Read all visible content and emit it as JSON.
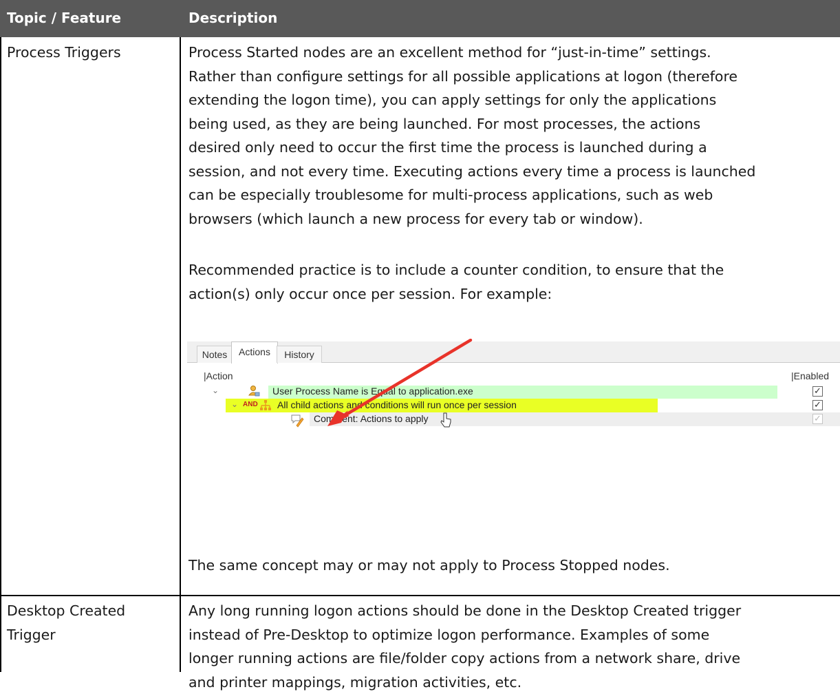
{
  "table": {
    "headers": [
      "Topic / Feature",
      "Description"
    ],
    "rows": [
      {
        "topic": "Process Triggers",
        "para1_lines": [
          "Process Started nodes are an excellent method for “just-in-time” settings.",
          "Rather than configure settings for all possible applications at logon (therefore",
          "extending the logon time), you can apply settings for only the applications",
          "being used, as they are being launched. For most processes, the actions",
          "desired only need to occur the first time the process is launched during a",
          "session, and not every time. Executing actions every time a process is launched",
          "can be especially troublesome for multi-process applications, such as web",
          "browsers (which launch a new process for every tab or window)."
        ],
        "para2_lines": [
          "Recommended practice is to include a counter condition, to ensure that the",
          "action(s) only occur once per session. For example:"
        ],
        "para3": "The same concept may or may not apply to Process Stopped nodes."
      },
      {
        "topic_lines": [
          "Desktop Created",
          "Trigger"
        ],
        "desc_lines": [
          "Any long running logon actions should be done in the Desktop Created trigger",
          "instead of Pre-Desktop to optimize logon performance.  Examples of some",
          "longer running actions are file/folder copy actions from a network share, drive",
          "and printer mappings, migration activities, etc."
        ]
      }
    ]
  },
  "screenshot": {
    "tabs": [
      "Notes",
      "Actions",
      "History"
    ],
    "active_tab": "Actions",
    "columns": [
      "|Action",
      "|Enabled"
    ],
    "rows": [
      {
        "text": "User Process Name is Equal to application.exe",
        "enabled": true,
        "highlight": "#ccffcc"
      },
      {
        "prefix": "AND",
        "text": "All child actions and conditions will run once per session",
        "enabled": true,
        "highlight": "#e9ff25"
      },
      {
        "text": "Comment:  Actions to apply",
        "enabled": true,
        "dimmed": true
      }
    ],
    "annotation_arrow_color": "#e8332a"
  }
}
